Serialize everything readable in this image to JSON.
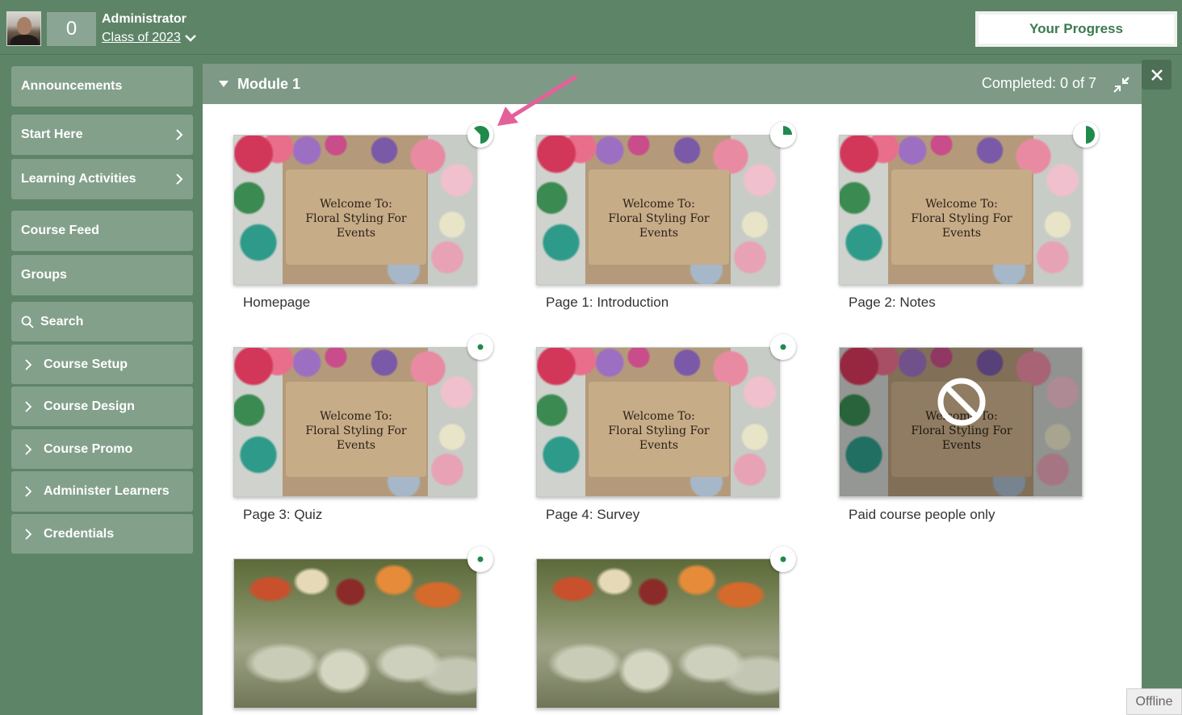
{
  "header": {
    "points": "0",
    "user_role": "Administrator",
    "user_class": "Class of 2023",
    "progress_button": "Your Progress"
  },
  "sidebar": {
    "items": [
      {
        "label": "Announcements",
        "type": "plain"
      },
      {
        "label": "Start Here",
        "type": "submenu"
      },
      {
        "label": "Learning Activities",
        "type": "submenu"
      },
      {
        "label": "Course Feed",
        "type": "plain"
      },
      {
        "label": "Groups",
        "type": "plain"
      },
      {
        "label": "Search",
        "type": "search"
      },
      {
        "label": "Course Setup",
        "type": "expandable"
      },
      {
        "label": "Course Design",
        "type": "expandable"
      },
      {
        "label": "Course Promo",
        "type": "expandable"
      },
      {
        "label": "Administer Learners",
        "type": "expandable"
      },
      {
        "label": "Credentials",
        "type": "expandable"
      }
    ]
  },
  "module": {
    "title": "Module 1",
    "completed": "Completed: 0 of 7",
    "cards": [
      {
        "label": "Homepage",
        "image": "floral",
        "image_text": [
          "Welcome To:",
          "Floral Styling For",
          "Events"
        ],
        "status": "partial-half",
        "locked": false
      },
      {
        "label": "Page 1: Introduction",
        "image": "floral",
        "image_text": [
          "Welcome To:",
          "Floral Styling For",
          "Events"
        ],
        "status": "partial-quarter",
        "locked": false
      },
      {
        "label": "Page 2: Notes",
        "image": "floral",
        "image_text": [
          "Welcome To:",
          "Floral Styling For",
          "Events"
        ],
        "status": "partial-half",
        "locked": false
      },
      {
        "label": "Page 3: Quiz",
        "image": "floral",
        "image_text": [
          "Welcome To:",
          "Floral Styling For",
          "Events"
        ],
        "status": "not-started",
        "locked": false
      },
      {
        "label": "Page 4: Survey",
        "image": "floral",
        "image_text": [
          "Welcome To:",
          "Floral Styling For",
          "Events"
        ],
        "status": "not-started",
        "locked": false
      },
      {
        "label": "Paid course people only",
        "image": "floral",
        "image_text": [
          "Welcome To:",
          "Floral Styling For",
          "Events"
        ],
        "status": "none",
        "locked": true
      },
      {
        "label": "",
        "image": "glasses",
        "image_text": [],
        "status": "not-started",
        "locked": false
      },
      {
        "label": "",
        "image": "glasses",
        "image_text": [],
        "status": "not-started",
        "locked": false
      }
    ]
  },
  "footer": {
    "offline": "Offline"
  },
  "colors": {
    "brand_green": "#5e8468",
    "sidebar_item": "#83a08b",
    "status_green": "#1f8a4c",
    "annotation_arrow": "#e4609a"
  }
}
